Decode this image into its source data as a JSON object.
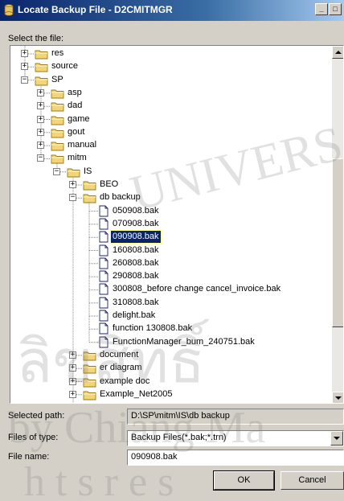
{
  "window": {
    "title": "Locate Backup File - D2CMITMGR",
    "minimize_glyph": "_",
    "maximize_glyph": "□"
  },
  "select_label": "Select the file:",
  "tree": [
    {
      "label": "res",
      "kind": "folder",
      "expander": "+"
    },
    {
      "label": "source",
      "kind": "folder",
      "expander": "+"
    },
    {
      "label": "SP",
      "kind": "folder",
      "expander": "−"
    },
    {
      "label": "asp",
      "kind": "folder",
      "expander": "+"
    },
    {
      "label": "dad",
      "kind": "folder",
      "expander": "+"
    },
    {
      "label": "game",
      "kind": "folder",
      "expander": "+"
    },
    {
      "label": "gout",
      "kind": "folder",
      "expander": "+"
    },
    {
      "label": "manual",
      "kind": "folder",
      "expander": "+"
    },
    {
      "label": "mitm",
      "kind": "folder",
      "expander": "−"
    },
    {
      "label": "IS",
      "kind": "folder",
      "expander": "−"
    },
    {
      "label": "BEO",
      "kind": "folder",
      "expander": "+"
    },
    {
      "label": "db backup",
      "kind": "folder",
      "expander": "−"
    },
    {
      "label": "050908.bak",
      "kind": "file"
    },
    {
      "label": "070908.bak",
      "kind": "file"
    },
    {
      "label": "090908.bak",
      "kind": "file",
      "selected": true
    },
    {
      "label": "160808.bak",
      "kind": "file"
    },
    {
      "label": "260808.bak",
      "kind": "file"
    },
    {
      "label": "290808.bak",
      "kind": "file"
    },
    {
      "label": "300808_before change cancel_invoice.bak",
      "kind": "file"
    },
    {
      "label": "310808.bak",
      "kind": "file"
    },
    {
      "label": "delight.bak",
      "kind": "file"
    },
    {
      "label": "function 130808.bak",
      "kind": "file"
    },
    {
      "label": "FunctionManager_bum_240751.bak",
      "kind": "file"
    },
    {
      "label": "document",
      "kind": "folder",
      "expander": "+"
    },
    {
      "label": "er diagram",
      "kind": "folder",
      "expander": "+"
    },
    {
      "label": "example doc",
      "kind": "folder",
      "expander": "+"
    },
    {
      "label": "Example_Net2005",
      "kind": "folder",
      "expander": "+"
    }
  ],
  "selected_path": {
    "label": "Selected path:",
    "value": "D:\\SP\\mitm\\IS\\db backup"
  },
  "files_of_type": {
    "label": "Files of type:",
    "value": "Backup Files(*.bak;*.trn)"
  },
  "file_name": {
    "label": "File name:",
    "value": "090908.bak"
  },
  "buttons": {
    "ok": "OK",
    "cancel": "Cancel"
  },
  "watermark": {
    "lines": [
      "UNIVERS",
      "ลิขสิทธิ์",
      "by Chiang Ma",
      "h t s   r e s"
    ]
  },
  "colors": {
    "title_active": "#0a246a",
    "face": "#d4d0c8",
    "selection": "#0a246a",
    "folder": "#f2d479"
  }
}
